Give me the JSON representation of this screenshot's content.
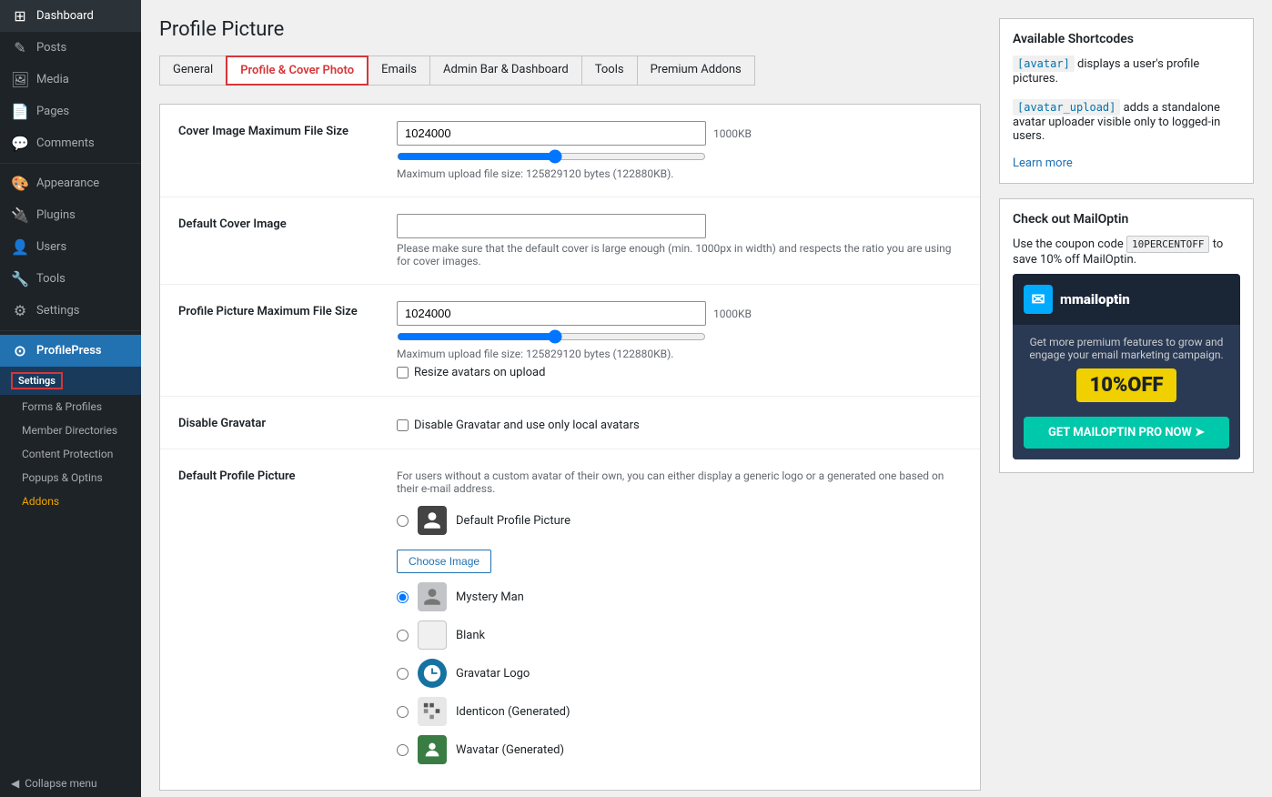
{
  "sidebar": {
    "items": [
      {
        "id": "dashboard",
        "label": "Dashboard",
        "icon": "⊞"
      },
      {
        "id": "posts",
        "label": "Posts",
        "icon": "✎"
      },
      {
        "id": "media",
        "label": "Media",
        "icon": "🖼"
      },
      {
        "id": "pages",
        "label": "Pages",
        "icon": "📄"
      },
      {
        "id": "comments",
        "label": "Comments",
        "icon": "💬"
      },
      {
        "id": "appearance",
        "label": "Appearance",
        "icon": "🎨"
      },
      {
        "id": "plugins",
        "label": "Plugins",
        "icon": "🔌"
      },
      {
        "id": "users",
        "label": "Users",
        "icon": "👤"
      },
      {
        "id": "tools",
        "label": "Tools",
        "icon": "🔧"
      },
      {
        "id": "settings",
        "label": "Settings",
        "icon": "⚙"
      }
    ],
    "profilepress": {
      "label": "ProfilePress",
      "icon": "⊙",
      "sub_items": [
        {
          "id": "pp-settings",
          "label": "Settings",
          "active": true
        },
        {
          "id": "pp-forms",
          "label": "Forms & Profiles"
        },
        {
          "id": "pp-directories",
          "label": "Member Directories"
        },
        {
          "id": "pp-protection",
          "label": "Content Protection"
        },
        {
          "id": "pp-popups",
          "label": "Popups & Optins"
        },
        {
          "id": "pp-addons",
          "label": "Addons",
          "highlight": true
        }
      ]
    },
    "collapse_label": "Collapse menu"
  },
  "page": {
    "title": "Profile Picture",
    "tabs": [
      {
        "id": "general",
        "label": "General",
        "active": false
      },
      {
        "id": "profile-cover",
        "label": "Profile & Cover Photo",
        "active": true
      },
      {
        "id": "emails",
        "label": "Emails",
        "active": false
      },
      {
        "id": "admin-bar",
        "label": "Admin Bar & Dashboard",
        "active": false
      },
      {
        "id": "tools",
        "label": "Tools",
        "active": false
      },
      {
        "id": "premium-addons",
        "label": "Premium Addons",
        "active": false
      }
    ]
  },
  "form": {
    "cover_image": {
      "label": "Cover Image Maximum File Size",
      "value": "1024000",
      "unit": "1000KB",
      "hint": "Maximum upload file size: 125829120 bytes (122880KB)."
    },
    "default_cover": {
      "label": "Default Cover Image",
      "value": "",
      "hint": "Please make sure that the default cover is large enough (min. 1000px in width) and respects the ratio you are using for cover images."
    },
    "profile_picture_size": {
      "label": "Profile Picture Maximum File Size",
      "value": "1024000",
      "unit": "1000KB",
      "hint": "Maximum upload file size: 125829120 bytes (122880KB).",
      "resize_label": "Resize avatars on upload"
    },
    "disable_gravatar": {
      "label": "Disable Gravatar",
      "checkbox_label": "Disable Gravatar and use only local avatars"
    },
    "default_profile": {
      "label": "Default Profile Picture",
      "description": "For users without a custom avatar of their own, you can either display a generic logo or a generated one based on their e-mail address.",
      "options": [
        {
          "id": "custom",
          "label": "Default Profile Picture",
          "icon": "person",
          "selected": false
        },
        {
          "id": "mystery",
          "label": "Mystery Man",
          "icon": "mystery",
          "selected": true
        },
        {
          "id": "blank",
          "label": "Blank",
          "icon": "blank",
          "selected": false
        },
        {
          "id": "gravatar-logo",
          "label": "Gravatar Logo",
          "icon": "gravatar",
          "selected": false
        },
        {
          "id": "identicon",
          "label": "Identicon (Generated)",
          "icon": "identicon",
          "selected": false
        },
        {
          "id": "wavatar",
          "label": "Wavatar (Generated)",
          "icon": "wavatar",
          "selected": false
        }
      ],
      "choose_image_label": "Choose Image"
    }
  },
  "right_sidebar": {
    "shortcodes": {
      "title": "Available Shortcodes",
      "avatar_shortcode": "[avatar]",
      "avatar_desc": "displays a user's profile pictures.",
      "avatar_upload_shortcode": "[avatar_upload]",
      "avatar_upload_desc": "adds a standalone avatar uploader visible only to logged-in users.",
      "learn_more_label": "Learn more"
    },
    "mailoptin": {
      "title": "Check out MailOptin",
      "description": "Use the coupon code",
      "coupon": "10PERCENTOFF",
      "description2": "to save 10% off MailOptin.",
      "logo_symbol": "M",
      "brand_name": "mailoptin",
      "tagline": "Get more premium features to grow and engage your email marketing campaign.",
      "discount": "10%OFF",
      "cta_label": "GET MAILOPTIN PRO NOW ➤"
    }
  }
}
